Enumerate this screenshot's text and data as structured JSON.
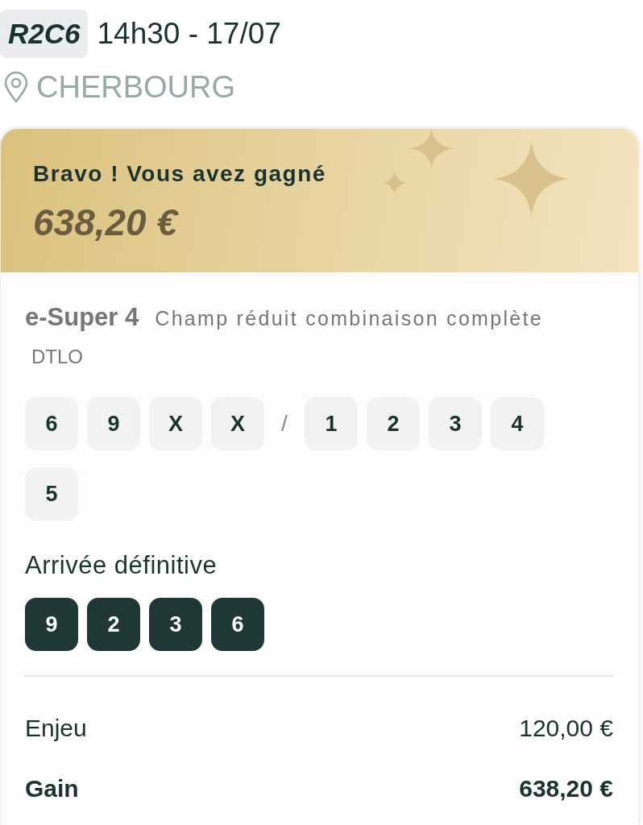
{
  "race": {
    "code": "R2C6",
    "time": "14h30 - 17/07",
    "venue": "CHERBOURG"
  },
  "win_banner": {
    "title": "Bravo ! Vous avez gagné",
    "amount": "638,20 €"
  },
  "bet": {
    "type": "e-Super 4",
    "formula": "Champ réduit combinaison complète",
    "subtitle": "DTLO",
    "selection": [
      {
        "kind": "number",
        "label": "6"
      },
      {
        "kind": "number",
        "label": "9"
      },
      {
        "kind": "number",
        "label": "X"
      },
      {
        "kind": "number",
        "label": "X"
      },
      {
        "kind": "separator",
        "label": "/"
      },
      {
        "kind": "number",
        "label": "1"
      },
      {
        "kind": "number",
        "label": "2"
      },
      {
        "kind": "number",
        "label": "3"
      },
      {
        "kind": "number",
        "label": "4"
      },
      {
        "kind": "number",
        "label": "5"
      }
    ]
  },
  "arrival": {
    "title": "Arrivée définitive",
    "numbers": [
      "9",
      "2",
      "3",
      "6"
    ]
  },
  "summary": [
    {
      "kind": "regular",
      "label": "Enjeu",
      "value": "120,00 €"
    },
    {
      "kind": "total",
      "label": "Gain",
      "value": "638,20 €"
    }
  ]
}
